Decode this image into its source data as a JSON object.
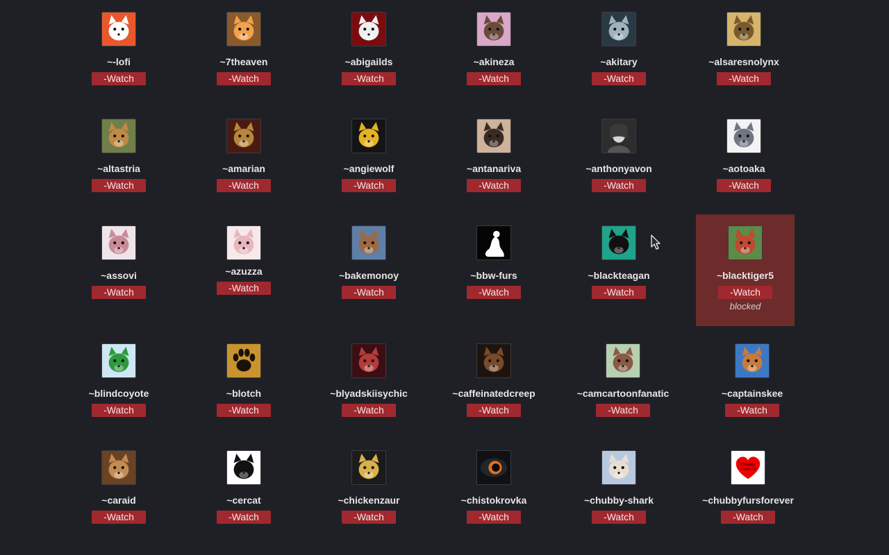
{
  "watch_label": "-Watch",
  "users": [
    {
      "name": "~-lofi",
      "icon": "white-cat-with-pipe-avatar-icon",
      "bg": "#e9572c",
      "fg": "#ffffff"
    },
    {
      "name": "~7theaven",
      "icon": "bear-with-hat-avatar-icon",
      "bg": "#8a5a2b",
      "fg": "#f1a24c"
    },
    {
      "name": "~abigailds",
      "icon": "white-wolf-red-bg-avatar-icon",
      "bg": "#7a0c10",
      "fg": "#f0f0f0"
    },
    {
      "name": "~akineza",
      "icon": "pink-creature-avatar-icon",
      "bg": "#d9a7c8",
      "fg": "#6b4a3a"
    },
    {
      "name": "~akitary",
      "icon": "dark-dragon-avatar-icon",
      "bg": "#2a3a44",
      "fg": "#9fb3bd"
    },
    {
      "name": "~alsaresnolynx",
      "icon": "lynx-avatar-icon",
      "bg": "#d7b46a",
      "fg": "#7a5a2c"
    },
    {
      "name": "~altastria",
      "icon": "lion-avatar-icon",
      "bg": "#6f7f49",
      "fg": "#c08a45"
    },
    {
      "name": "~amarian",
      "icon": "armored-bird-avatar-icon",
      "bg": "#4a1a12",
      "fg": "#b8863a"
    },
    {
      "name": "~angiewolf",
      "icon": "yellow-wolf-logo-avatar-icon",
      "bg": "#141414",
      "fg": "#e4b320"
    },
    {
      "name": "~antanariva",
      "icon": "dog-face-avatar-icon",
      "bg": "#cdb39b",
      "fg": "#3a2a22"
    },
    {
      "name": "~anthonyavon",
      "icon": "person-photo-avatar-icon",
      "bg": "#2d2d2d",
      "fg": "#d6d6d6"
    },
    {
      "name": "~aotoaka",
      "icon": "grey-wolf-avatar-icon",
      "bg": "#f3f3f3",
      "fg": "#6f7583"
    },
    {
      "name": "~assovi",
      "icon": "pink-haired-fox-avatar-icon",
      "bg": "#efe4ea",
      "fg": "#c98a98"
    },
    {
      "name": "~azuzza",
      "icon": "pink-bear-avatar-icon",
      "bg": "#f6e9ea",
      "fg": "#e7b7bd"
    },
    {
      "name": "~bakemonoy",
      "icon": "fox-with-glasses-avatar-icon",
      "bg": "#5f7fa8",
      "fg": "#9b6a45"
    },
    {
      "name": "~bbw-furs",
      "icon": "white-silhouette-avatar-icon",
      "bg": "#050505",
      "fg": "#ffffff"
    },
    {
      "name": "~blackteagan",
      "icon": "black-wolf-teal-bg-avatar-icon",
      "bg": "#1fa38a",
      "fg": "#101010"
    },
    {
      "name": "~blacktiger5",
      "icon": "red-dragon-green-bg-avatar-icon",
      "bg": "#5e8a4a",
      "fg": "#c0492f",
      "status": "blocked"
    },
    {
      "name": "~blindcoyote",
      "icon": "hand-drawn-coyote-avatar-icon",
      "bg": "#cde8f3",
      "fg": "#2e9a3f"
    },
    {
      "name": "~blotch",
      "icon": "paw-print-avatar-icon",
      "bg": "#c9942e",
      "fg": "#1a1208"
    },
    {
      "name": "~blyadskiisychic",
      "icon": "red-haired-character-avatar-icon",
      "bg": "#3a0e12",
      "fg": "#b33b3b"
    },
    {
      "name": "~caffeinatedcreep",
      "icon": "dark-creature-avatar-icon",
      "bg": "#1d1410",
      "fg": "#7a4a2a"
    },
    {
      "name": "~camcartoonfanatic",
      "icon": "cartoon-bear-avatar-icon",
      "bg": "#b6d0b0",
      "fg": "#8a5a44"
    },
    {
      "name": "~captainskee",
      "icon": "hyena-sunglasses-avatar-icon",
      "bg": "#3c79c4",
      "fg": "#c87b3d"
    },
    {
      "name": "~caraid",
      "icon": "brown-lynx-avatar-icon",
      "bg": "#6a4324",
      "fg": "#c48b52"
    },
    {
      "name": "~cercat",
      "icon": "sketch-cat-halo-avatar-icon",
      "bg": "#ffffff",
      "fg": "#111111"
    },
    {
      "name": "~chickenzaur",
      "icon": "yellow-bird-headphones-avatar-icon",
      "bg": "#1b1b1b",
      "fg": "#d9b14a"
    },
    {
      "name": "~chistokrovka",
      "icon": "eye-closeup-avatar-icon",
      "bg": "#0f1114",
      "fg": "#e0701f"
    },
    {
      "name": "~chubby-shark",
      "icon": "shark-avatar-icon",
      "bg": "#b8c8e0",
      "fg": "#e8ded2"
    },
    {
      "name": "~chubbyfursforever",
      "icon": "red-heart-avatar-icon",
      "bg": "#ffffff",
      "fg": "#ee0000",
      "heart_text": "Chubby Furs! <3"
    }
  ]
}
